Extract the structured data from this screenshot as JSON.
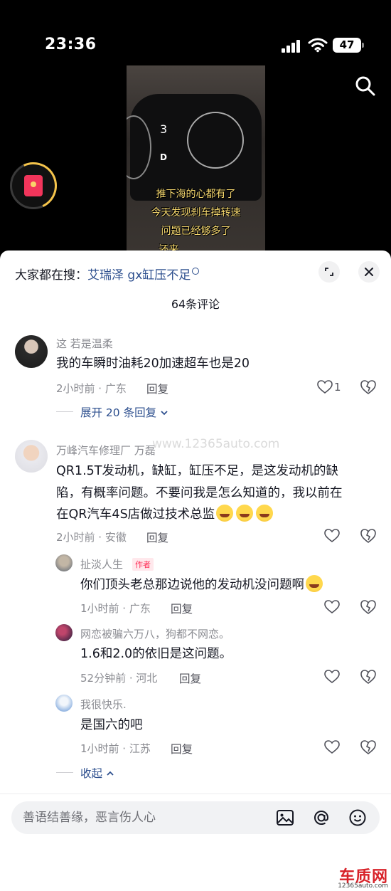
{
  "status_bar": {
    "time": "23:36",
    "battery": "47"
  },
  "video": {
    "caption_lines": [
      "推下海的心都有了",
      "今天发现刹车掉转速",
      "问题已经够多了",
      "还来"
    ],
    "dash_gear": "3",
    "dash_drive": "D"
  },
  "sheet": {
    "hot_search_prefix": "大家都在搜：",
    "hot_search_keyword": "艾瑞泽 gx缸压不足",
    "comment_count": "64条评论",
    "watermark": "www.12365auto.com"
  },
  "comments": [
    {
      "username": "这 若是温柔",
      "content": "我的车瞬时油耗20加速超车也是20",
      "time_location": "2小时前 · 广东",
      "reply_label": "回复",
      "like_count": "1",
      "expand_label": "展开 20 条回复"
    },
    {
      "username": "万峰汽车修理厂 万磊",
      "content_lines": [
        "QR1.5T发动机，缺缸，缸压不足，是这发动机的缺",
        "陷，有概率问题。不要问我是怎么知道的，我以前在",
        "在QR汽车4S店做过技术总监"
      ],
      "time_location": "2小时前 · 安徽",
      "reply_label": "回复",
      "emoji_name": "laugh-cry-emoji",
      "replies": [
        {
          "username": "扯淡人生",
          "author_tag": "作者",
          "content": "你们顶头老总那边说他的发动机没问题啊",
          "emoji_name": "grin-emoji",
          "time_location": "1小时前 · 广东",
          "reply_label": "回复"
        },
        {
          "username": "网恋被骗六万八，狗都不网恋。",
          "content": "1.6和2.0的依旧是这问题。",
          "time_location": "52分钟前 · 河北",
          "reply_label": "回复"
        },
        {
          "username": "我很快乐.",
          "content": "是国六的吧",
          "time_location": "1小时前 · 江苏",
          "reply_label": "回复"
        }
      ],
      "collapse_label": "收起"
    }
  ],
  "input": {
    "placeholder": "善语结善缘，恶言伤人心"
  },
  "site_logo": {
    "name": "车质网",
    "url": "12365auto.com"
  },
  "colors": {
    "accent_link": "#2d4f8e",
    "author_tag": "#fe2c55",
    "meta_gray": "#8a8b91"
  }
}
